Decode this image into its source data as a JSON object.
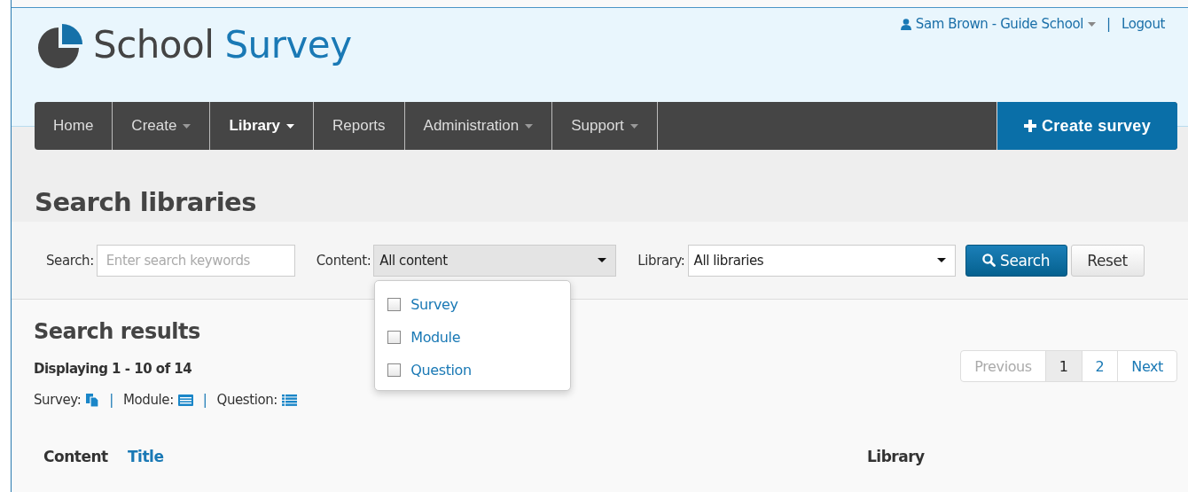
{
  "logo": {
    "word_1": "School",
    "word_2": "Survey"
  },
  "user_menu": {
    "user": "Sam Brown - Guide School",
    "separator": "|",
    "logout": "Logout"
  },
  "nav": [
    {
      "label": "Home",
      "dropdown": false,
      "selected": false
    },
    {
      "label": "Create",
      "dropdown": true,
      "selected": false
    },
    {
      "label": "Library",
      "dropdown": true,
      "selected": true
    },
    {
      "label": "Reports",
      "dropdown": false,
      "selected": false
    },
    {
      "label": "Administration",
      "dropdown": true,
      "selected": false
    },
    {
      "label": "Support",
      "dropdown": true,
      "selected": false
    }
  ],
  "create_button": {
    "label": "Create survey"
  },
  "page_title": "Search libraries",
  "filters": {
    "search_label": "Search:",
    "search_placeholder": "Enter search keywords",
    "content_label": "Content:",
    "content_value": "All content",
    "content_open": true,
    "library_label": "Library:",
    "library_value": "All libraries",
    "search_button": "Search",
    "reset_button": "Reset"
  },
  "content_options": [
    {
      "label": "Survey",
      "checked": false
    },
    {
      "label": "Module",
      "checked": false
    },
    {
      "label": "Question",
      "checked": false
    }
  ],
  "results": {
    "title": "Search results",
    "summary": "Displaying 1 - 10 of 14",
    "separator": "|",
    "legend": [
      {
        "label": "Survey:",
        "kind": "survey"
      },
      {
        "label": "Module:",
        "kind": "module"
      },
      {
        "label": "Question:",
        "kind": "question"
      }
    ]
  },
  "pagination": [
    {
      "label": "Previous",
      "disabled": true,
      "selected": false
    },
    {
      "label": "1",
      "disabled": false,
      "selected": true
    },
    {
      "label": "2",
      "disabled": false,
      "selected": false
    },
    {
      "label": "Next",
      "disabled": false,
      "selected": false
    }
  ],
  "table": {
    "columns": [
      {
        "label": "Content",
        "sortable": false
      },
      {
        "label": "Title",
        "sortable": true
      },
      {
        "label": "Library",
        "sortable": false
      }
    ]
  }
}
